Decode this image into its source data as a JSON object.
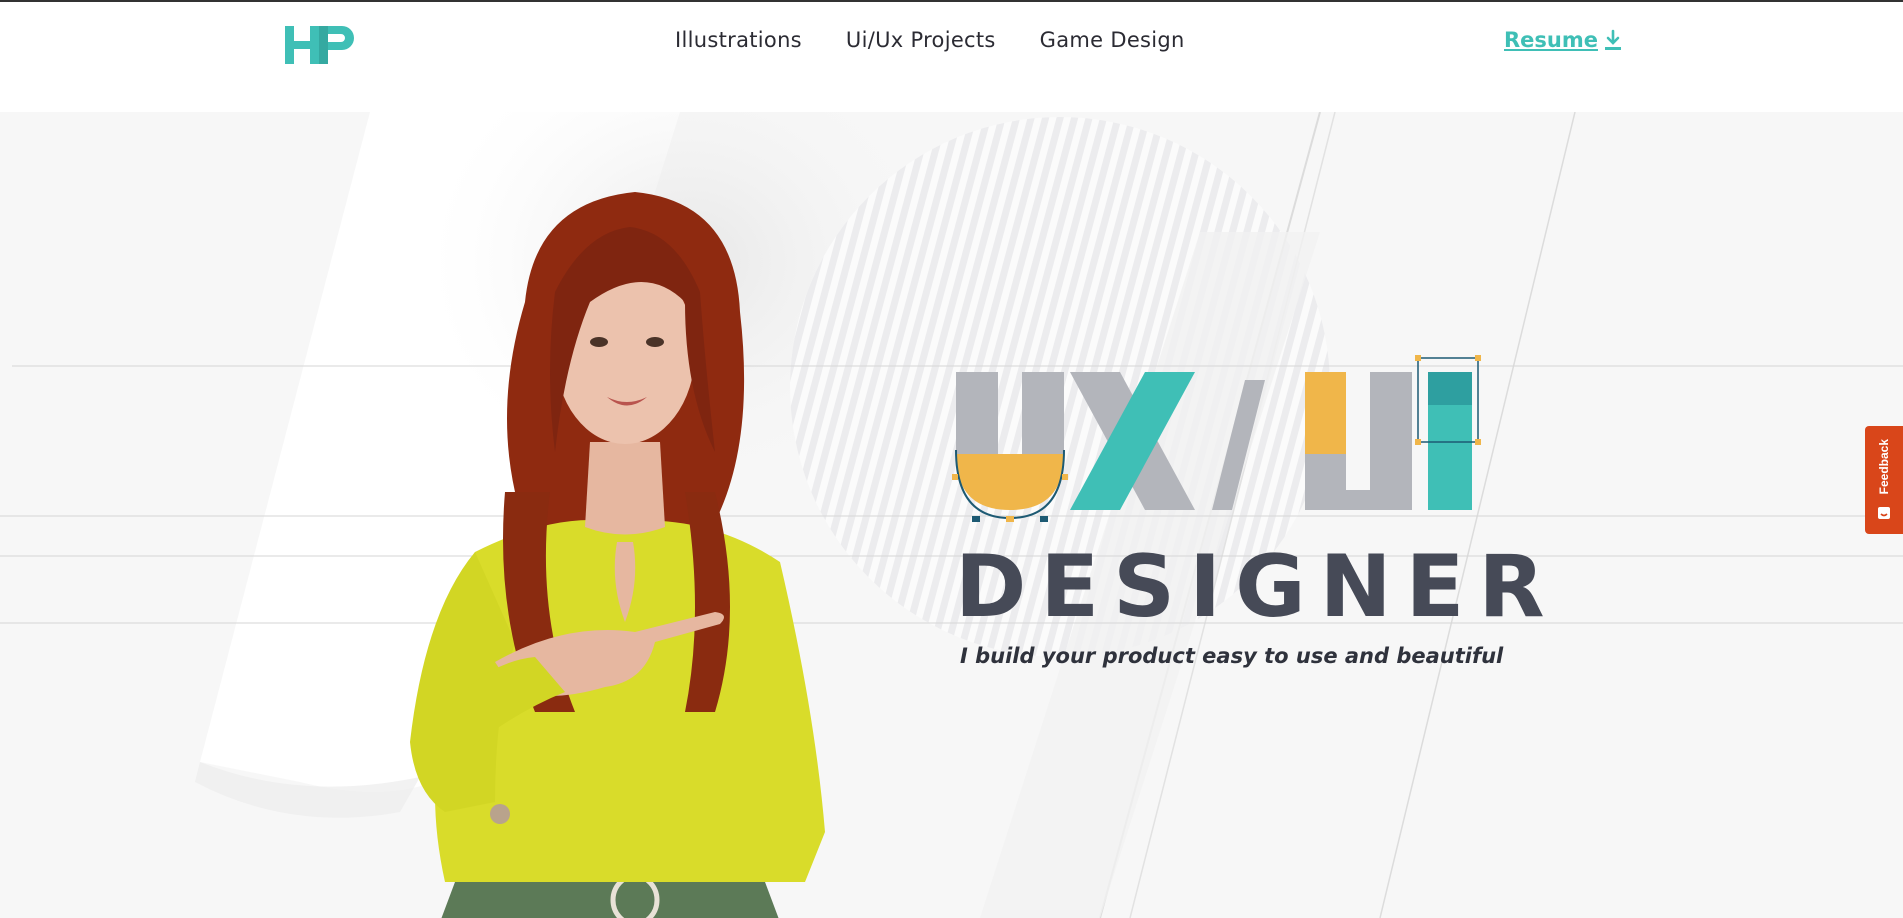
{
  "header": {
    "logo_text": "HP",
    "nav": [
      {
        "label": "Illustrations"
      },
      {
        "label": "Ui/Ux Projects"
      },
      {
        "label": "Game Design"
      }
    ],
    "resume_label": "Resume",
    "resume_icon": "download-icon"
  },
  "hero": {
    "art_letters": [
      "U",
      "X",
      "/",
      "U",
      "I"
    ],
    "headline": "DESIGNER",
    "tagline": "I build your product easy to use and beautiful"
  },
  "feedback": {
    "label": "Feedback",
    "icon": "feedback-icon"
  },
  "colors": {
    "accent": "#3fbfb6",
    "yellow": "#f0b64a",
    "gray_letters": "#b3b5bb",
    "dark_text": "#464a57",
    "feedback": "#d9461a"
  }
}
